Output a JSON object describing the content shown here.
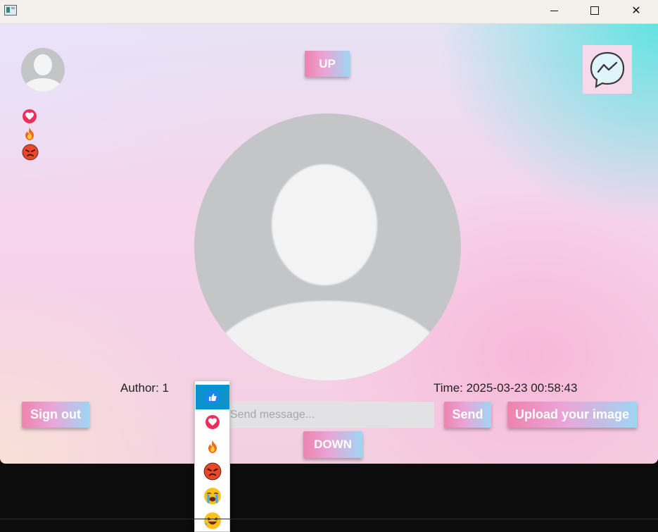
{
  "window": {
    "controls": {
      "minimize_icon": "minimize-icon",
      "maximize_icon": "maximize-icon",
      "close_icon": "close-icon",
      "close_glyph": "✕"
    }
  },
  "header": {
    "up_label": "UP"
  },
  "reactions_summary": [
    "heart-icon",
    "fire-icon",
    "angry-icon"
  ],
  "post": {
    "author": "Author: 1",
    "time": "Time: 2025-03-23 00:58:43"
  },
  "message": {
    "placeholder": "Send message...",
    "value": ""
  },
  "buttons": {
    "sign_out": "Sign out",
    "send": "Send",
    "upload": "Upload your image",
    "down": "DOWN"
  },
  "reaction_menu": {
    "selected": "like",
    "items": [
      "like-icon",
      "heart-icon",
      "fire-icon",
      "angry-icon",
      "crying-icon",
      "laughing-icon"
    ]
  },
  "colors": {
    "button_gradient": [
      "#ee83ae",
      "#e9a6d8",
      "#9ed5f4"
    ],
    "selected_item": "#0a93cc",
    "input_bg": "#e2e2e4"
  }
}
